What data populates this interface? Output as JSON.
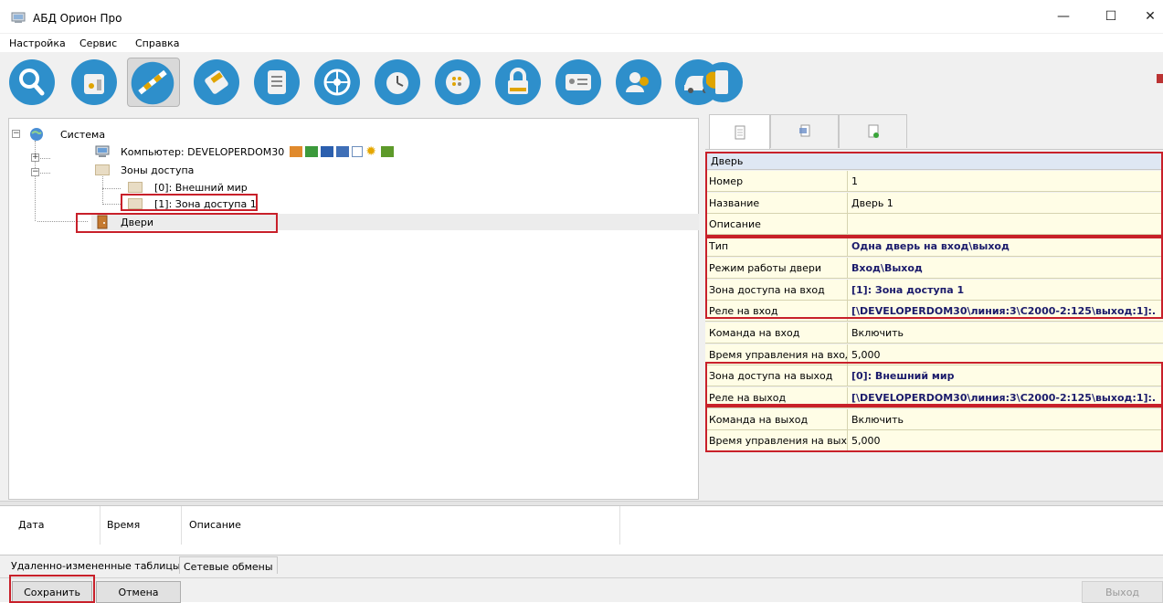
{
  "window": {
    "title": "АБД Орион Про",
    "controls": {
      "minimize": "—",
      "maximize": "☐",
      "close": "✕"
    }
  },
  "menu": [
    "Настройка",
    "Сервис",
    "Справка"
  ],
  "toolbar": {
    "buttons": [
      {
        "icon": "magnifier-icon"
      },
      {
        "icon": "controller-device-icon"
      },
      {
        "icon": "barrier-gate-icon",
        "active": true
      },
      {
        "icon": "access-key-icon"
      },
      {
        "icon": "list-document-icon"
      },
      {
        "icon": "wheel-icon"
      },
      {
        "icon": "alarm-clock-icon"
      },
      {
        "icon": "keypad-icon"
      },
      {
        "icon": "padlock-icon"
      },
      {
        "icon": "id-card-icon"
      },
      {
        "icon": "users-icon"
      },
      {
        "icon": "car-icon"
      },
      {
        "icon": "door-key-icon"
      }
    ]
  },
  "tree": {
    "root": "Система",
    "computer": "Компьютер: DEVELOPERDOM30",
    "zones": "Зоны доступа",
    "zone0": "[0]: Внешний мир",
    "zone1": "[1]: Зона доступа 1",
    "doors": "Двери"
  },
  "properties": {
    "header": "Дверь",
    "rows": [
      {
        "key": "Номер",
        "value": "1",
        "bold": false
      },
      {
        "key": "Название",
        "value": "Дверь 1",
        "bold": false
      },
      {
        "key": "Описание",
        "value": "",
        "bold": false
      },
      {
        "key": "Тип",
        "value": "Одна дверь на вход\\выход",
        "bold": true
      },
      {
        "key": "Режим работы двери",
        "value": "Вход\\Выход",
        "bold": true
      },
      {
        "key": "Зона доступа на вход",
        "value": "[1]: Зона доступа 1",
        "bold": true
      },
      {
        "key": "Реле на вход",
        "value": "[\\DEVELOPERDOM30\\линия:3\\С2000-2:125\\выход:1]:.",
        "bold": true
      },
      {
        "key": "Команда на вход",
        "value": "Включить",
        "bold": false
      },
      {
        "key": "Время управления на вход",
        "value": "5,000",
        "bold": false
      },
      {
        "key": "Зона доступа на выход",
        "value": "[0]: Внешний мир",
        "bold": true
      },
      {
        "key": "Реле на выход",
        "value": "[\\DEVELOPERDOM30\\линия:3\\С2000-2:125\\выход:1]:.",
        "bold": true
      },
      {
        "key": "Команда на выход",
        "value": "Включить",
        "bold": false
      },
      {
        "key": "Время управления на вых...",
        "value": "5,000",
        "bold": false
      }
    ]
  },
  "log": {
    "columns": [
      "Дата",
      "Время",
      "Описание"
    ]
  },
  "bottom_tabs": [
    "Удаленно-измененные таблицы",
    "Сетевые обмены"
  ],
  "actions": {
    "save": "Сохранить",
    "cancel": "Отмена",
    "exit": "Выход"
  },
  "colors": {
    "highlight": "#c8202a",
    "grid_bg": "#fffde6",
    "header_bg": "#dfe7f3"
  }
}
